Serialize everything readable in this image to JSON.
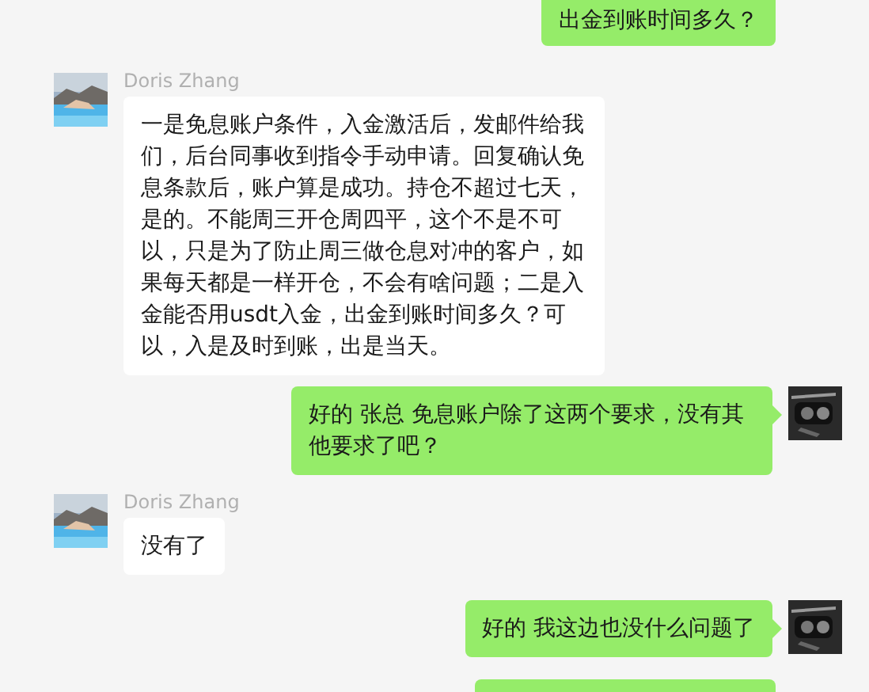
{
  "messages": [
    {
      "kind": "out-partial",
      "text": "出金到账时间多久？"
    },
    {
      "kind": "in",
      "sender": "Doris Zhang",
      "text": "一是免息账户条件，入金激活后，发邮件给我们，后台同事收到指令手动申请。回复确认免息条款后，账户算是成功。持仓不超过七天，是的。不能周三开仓周四平，这个不是不可以，只是为了防止周三做仓息对冲的客户，如果每天都是一样开仓，不会有啥问题；二是入金能否用usdt入金，出金到账时间多久？可以，入是及时到账，出是当天。"
    },
    {
      "kind": "out",
      "text": "好的 张总  免息账户除了这两个要求，没有其他要求了吧？"
    },
    {
      "kind": "in",
      "sender": "Doris Zhang",
      "text": "没有了"
    },
    {
      "kind": "out",
      "text": "好的 我这边也没什么问题了"
    },
    {
      "kind": "out-stub"
    }
  ]
}
